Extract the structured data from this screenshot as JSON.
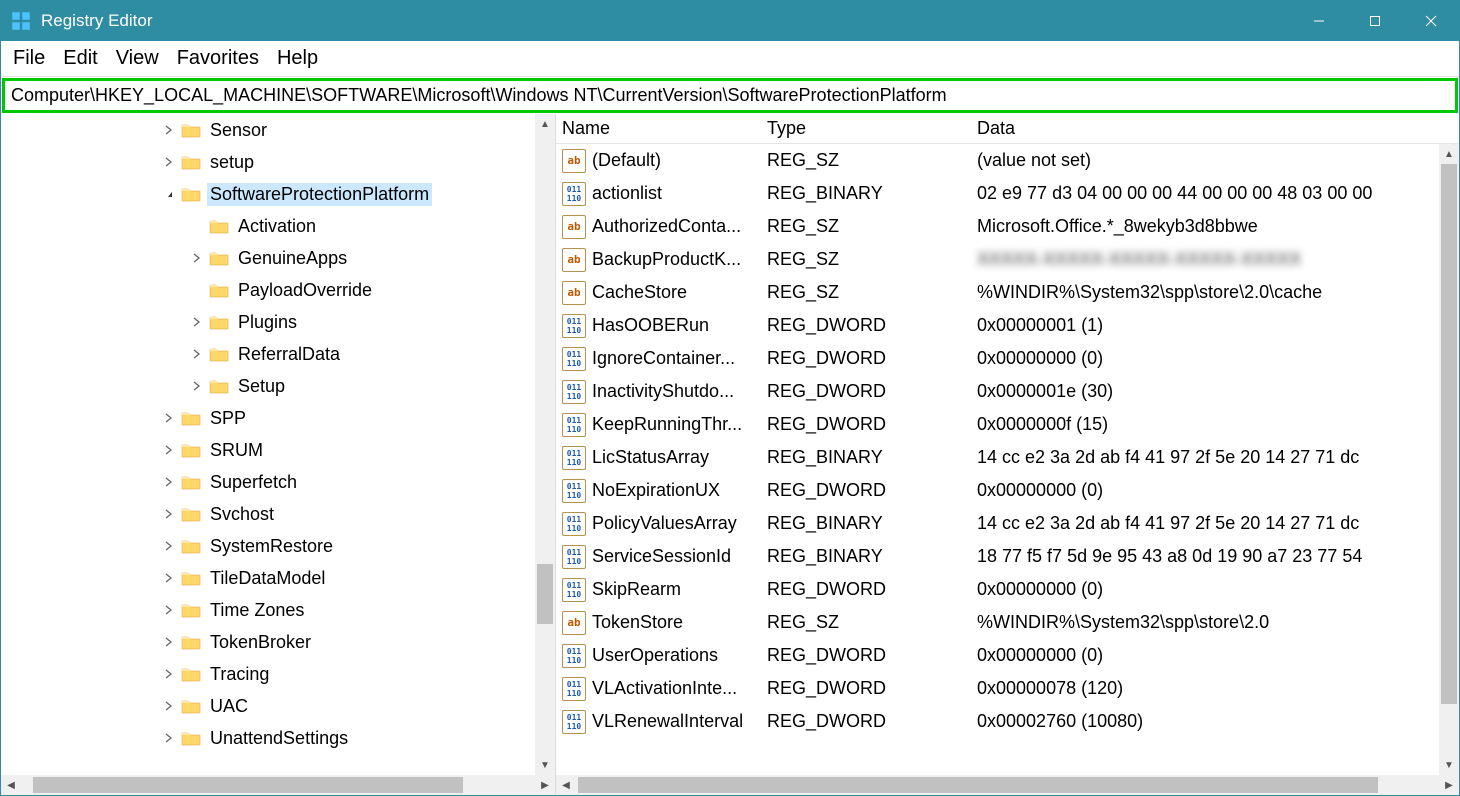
{
  "title": "Registry Editor",
  "menu": [
    "File",
    "Edit",
    "View",
    "Favorites",
    "Help"
  ],
  "path": "Computer\\HKEY_LOCAL_MACHINE\\SOFTWARE\\Microsoft\\Windows NT\\CurrentVersion\\SoftwareProtectionPlatform",
  "tree": [
    {
      "level": 5,
      "exp": ">",
      "label": "Sensor"
    },
    {
      "level": 5,
      "exp": ">",
      "label": "setup"
    },
    {
      "level": 5,
      "exp": "v",
      "label": "SoftwareProtectionPlatform",
      "selected": true
    },
    {
      "level": 6,
      "exp": "",
      "label": "Activation"
    },
    {
      "level": 6,
      "exp": ">",
      "label": "GenuineApps"
    },
    {
      "level": 6,
      "exp": "",
      "label": "PayloadOverride"
    },
    {
      "level": 6,
      "exp": ">",
      "label": "Plugins"
    },
    {
      "level": 6,
      "exp": ">",
      "label": "ReferralData"
    },
    {
      "level": 6,
      "exp": ">",
      "label": "Setup"
    },
    {
      "level": 5,
      "exp": ">",
      "label": "SPP"
    },
    {
      "level": 5,
      "exp": ">",
      "label": "SRUM"
    },
    {
      "level": 5,
      "exp": ">",
      "label": "Superfetch"
    },
    {
      "level": 5,
      "exp": ">",
      "label": "Svchost"
    },
    {
      "level": 5,
      "exp": ">",
      "label": "SystemRestore"
    },
    {
      "level": 5,
      "exp": ">",
      "label": "TileDataModel"
    },
    {
      "level": 5,
      "exp": ">",
      "label": "Time Zones"
    },
    {
      "level": 5,
      "exp": ">",
      "label": "TokenBroker"
    },
    {
      "level": 5,
      "exp": ">",
      "label": "Tracing"
    },
    {
      "level": 5,
      "exp": ">",
      "label": "UAC"
    },
    {
      "level": 5,
      "exp": ">",
      "label": "UnattendSettings"
    }
  ],
  "columns": {
    "name": "Name",
    "type": "Type",
    "data": "Data"
  },
  "values": [
    {
      "icon": "str",
      "name": "(Default)",
      "type": "REG_SZ",
      "data": "(value not set)"
    },
    {
      "icon": "bin",
      "name": "actionlist",
      "type": "REG_BINARY",
      "data": "02 e9 77 d3 04 00 00 00 44 00 00 00 48 03 00 00"
    },
    {
      "icon": "str",
      "name": "AuthorizedConta...",
      "type": "REG_SZ",
      "data": "Microsoft.Office.*_8wekyb3d8bbwe"
    },
    {
      "icon": "str",
      "name": "BackupProductK...",
      "type": "REG_SZ",
      "data": "XXXXX-XXXXX-XXXXX-XXXXX-XXXXX",
      "blur": true
    },
    {
      "icon": "str",
      "name": "CacheStore",
      "type": "REG_SZ",
      "data": "%WINDIR%\\System32\\spp\\store\\2.0\\cache"
    },
    {
      "icon": "bin",
      "name": "HasOOBERun",
      "type": "REG_DWORD",
      "data": "0x00000001 (1)"
    },
    {
      "icon": "bin",
      "name": "IgnoreContainer...",
      "type": "REG_DWORD",
      "data": "0x00000000 (0)"
    },
    {
      "icon": "bin",
      "name": "InactivityShutdo...",
      "type": "REG_DWORD",
      "data": "0x0000001e (30)"
    },
    {
      "icon": "bin",
      "name": "KeepRunningThr...",
      "type": "REG_DWORD",
      "data": "0x0000000f (15)"
    },
    {
      "icon": "bin",
      "name": "LicStatusArray",
      "type": "REG_BINARY",
      "data": "14 cc e2 3a 2d ab f4 41 97 2f 5e 20 14 27 71 dc"
    },
    {
      "icon": "bin",
      "name": "NoExpirationUX",
      "type": "REG_DWORD",
      "data": "0x00000000 (0)"
    },
    {
      "icon": "bin",
      "name": "PolicyValuesArray",
      "type": "REG_BINARY",
      "data": "14 cc e2 3a 2d ab f4 41 97 2f 5e 20 14 27 71 dc"
    },
    {
      "icon": "bin",
      "name": "ServiceSessionId",
      "type": "REG_BINARY",
      "data": "18 77 f5 f7 5d 9e 95 43 a8 0d 19 90 a7 23 77 54"
    },
    {
      "icon": "bin",
      "name": "SkipRearm",
      "type": "REG_DWORD",
      "data": "0x00000000 (0)"
    },
    {
      "icon": "str",
      "name": "TokenStore",
      "type": "REG_SZ",
      "data": "%WINDIR%\\System32\\spp\\store\\2.0"
    },
    {
      "icon": "bin",
      "name": "UserOperations",
      "type": "REG_DWORD",
      "data": "0x00000000 (0)"
    },
    {
      "icon": "bin",
      "name": "VLActivationInte...",
      "type": "REG_DWORD",
      "data": "0x00000078 (120)"
    },
    {
      "icon": "bin",
      "name": "VLRenewalInterval",
      "type": "REG_DWORD",
      "data": "0x00002760 (10080)"
    }
  ]
}
